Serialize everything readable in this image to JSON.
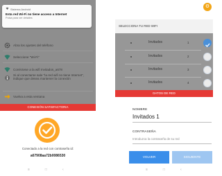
{
  "notification": {
    "app": "Sistema Android",
    "title": "Esta red Wi-Fi no tiene acceso a Internet",
    "subtitle": "Pulsa para ver detalles"
  },
  "steps": [
    {
      "icon": "gear-icon",
      "text": "Abra los ajustes del teléfono"
    },
    {
      "icon": "wifi-icon",
      "text": "Seleccione \"Wi-Fi\""
    },
    {
      "icon": "wifi-icon",
      "text": "Conéctese a la wifi Invitados_a678"
    },
    {
      "icon": "info-icon",
      "text": "Si al conectarse sale \"la red wifi no tiene Internet\", indique que desea mantener la conexión"
    },
    {
      "icon": "arrow-icon",
      "text": "Vuelva a esta ventana"
    }
  ],
  "left_status_bar": "CONEXIÓN SATISFACTORIA",
  "connected_text": "Conectado a la red con contraseña id:",
  "password_value": "a67908aa72b0086530",
  "right_header": "SELECCIONA TU RED WIFI",
  "wifi_networks": [
    {
      "name": "Invitados",
      "num": "1",
      "selected": true
    },
    {
      "name": "Invitados",
      "num": "2",
      "selected": false
    },
    {
      "name": "Invitados",
      "num": "3",
      "selected": false
    },
    {
      "name": "Invitados",
      "num": "4",
      "selected": false
    }
  ],
  "right_bar": "DATOS DE RED",
  "form": {
    "name_label": "NOMBRE",
    "name_value": "Invitados 1",
    "password_label": "CONTRASEÑA",
    "password_placeholder": "Introduzca la contraseña de su red"
  },
  "buttons": {
    "back": "VOLVER",
    "next": "SIGUIENTE"
  },
  "nav": [
    "≡",
    "□",
    "‹"
  ],
  "colors": {
    "accent_red": "#e53935",
    "orange": "#ffa726",
    "blue": "#3a8eea"
  }
}
